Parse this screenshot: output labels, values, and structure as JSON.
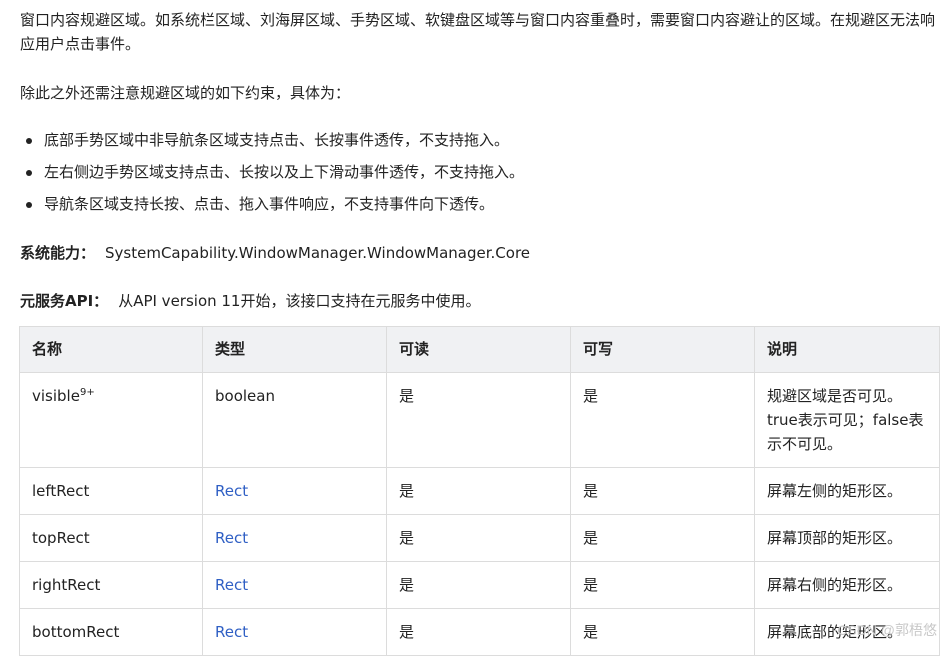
{
  "intro": {
    "paragraph1": "窗口内容规避区域。如系统栏区域、刘海屏区域、手势区域、软键盘区域等与窗口内容重叠时，需要窗口内容避让的区域。在规避区无法响应用户点击事件。",
    "paragraph2": "除此之外还需注意规避区域的如下约束，具体为："
  },
  "constraints": [
    "底部手势区域中非导航条区域支持点击、长按事件透传，不支持拖入。",
    "左右侧边手势区域支持点击、长按以及上下滑动事件透传，不支持拖入。",
    "导航条区域支持长按、点击、拖入事件响应，不支持事件向下透传。"
  ],
  "meta": {
    "syscap_label": "系统能力：",
    "syscap_value": "SystemCapability.WindowManager.WindowManager.Core",
    "atomic_label": "元服务API：",
    "atomic_value": "从API version 11开始，该接口支持在元服务中使用。"
  },
  "table": {
    "headers": [
      "名称",
      "类型",
      "可读",
      "可写",
      "说明"
    ],
    "rows": [
      {
        "name": "visible",
        "name_sup": "9+",
        "type": "boolean",
        "readable": "是",
        "writable": "是",
        "desc": "规避区域是否可见。true表示可见；false表示不可见。"
      },
      {
        "name": "leftRect",
        "type": "Rect",
        "readable": "是",
        "writable": "是",
        "desc": "屏幕左侧的矩形区。"
      },
      {
        "name": "topRect",
        "type": "Rect",
        "readable": "是",
        "writable": "是",
        "desc": "屏幕顶部的矩形区。"
      },
      {
        "name": "rightRect",
        "type": "Rect",
        "readable": "是",
        "writable": "是",
        "desc": "屏幕右侧的矩形区。"
      },
      {
        "name": "bottomRect",
        "type": "Rect",
        "readable": "是",
        "writable": "是",
        "desc": "屏幕底部的矩形区。"
      }
    ]
  },
  "watermark": "CSDN @郭梧悠",
  "colors": {
    "link": "#2f5fc4",
    "header_bg": "#f0f1f3",
    "border": "#dcdcdc"
  }
}
